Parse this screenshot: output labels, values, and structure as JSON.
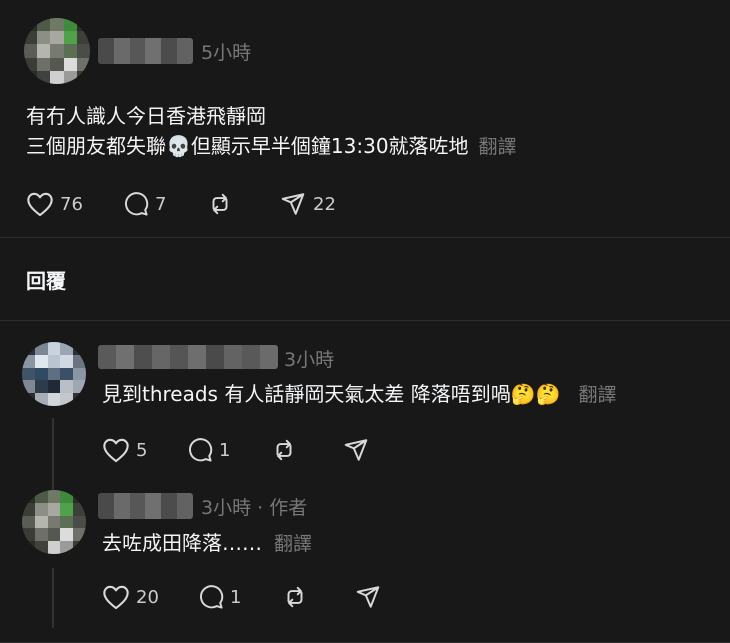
{
  "colors": {
    "background": "#181818",
    "text": "#f3f5f7",
    "muted": "#777777",
    "divider": "#2e2e2e"
  },
  "post": {
    "time": "5小時",
    "lines": [
      "有冇人識人今日香港飛靜岡",
      "三個朋友都失聯💀但顯示早半個鐘13:30就落咗地"
    ],
    "translate": "翻譯",
    "actions": {
      "likes": "76",
      "comments": "7",
      "shares": "22"
    }
  },
  "replies_heading": "回覆",
  "replies": [
    {
      "time": "3小時",
      "text": "見到threads 有人話靜岡天氣太差 降落唔到喎🤔🤔",
      "translate": "翻譯",
      "actions": {
        "likes": "5",
        "comments": "1"
      }
    },
    {
      "time": "3小時",
      "author_tag": "· 作者",
      "text": "去咗成田降落……",
      "translate": "翻譯",
      "actions": {
        "likes": "20",
        "comments": "1"
      }
    }
  ],
  "icons": [
    "heart-icon",
    "comment-icon",
    "repost-icon",
    "send-icon"
  ]
}
